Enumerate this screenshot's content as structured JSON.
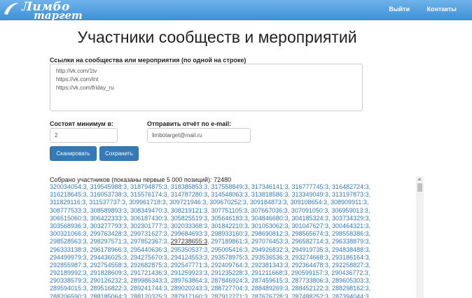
{
  "navbar": {
    "logo_line1": "Лимбо",
    "logo_line2": "таргет",
    "links": [
      "Выйти",
      "Контакты"
    ]
  },
  "page_title": "Участники сообществ и мероприятий",
  "links_field": {
    "label": "Ссылки на сообщества или мероприятия (по одной на строке)",
    "lines": [
      "http://vk.com/1tv",
      "https://vk.com/tnt",
      "https://vk.com/friday_ru"
    ]
  },
  "min_field": {
    "label": "Состоят минимум в:",
    "value": "2"
  },
  "email_field": {
    "label": "Отправить отчёт по e-mail:",
    "value": "limbotarget@mail.ru"
  },
  "buttons": {
    "scan": "Сканировать",
    "save": "Сохранить"
  },
  "results": {
    "title": "Собрано участников (показаны первые 5 000 позиций): 72480",
    "rows": [
      [
        "320034054:3",
        "319545988:3",
        "318794875:3",
        "318385853:3",
        "317558849:3",
        "317346141:3",
        "316777745:3",
        "316482724:3"
      ],
      [
        "316218645:3",
        "316053738:3",
        "315576174:3",
        "314787280:3",
        "314548063:3",
        "313818586:3",
        "313349049:3",
        "313197873:3"
      ],
      [
        "311829116:3",
        "311537737:3",
        "309961718:3",
        "309721946:3",
        "309670252:3",
        "309184873:3",
        "309108654:3",
        "308909911:3"
      ],
      [
        "308777533:3",
        "308589893:3",
        "308349470:3",
        "308219121:3",
        "307751105:3",
        "307667036:3",
        "307091050:3",
        "306959013:3"
      ],
      [
        "306515060:3",
        "306422333:3",
        "306187430:3",
        "305825519:3",
        "305646183:3",
        "304846680:3",
        "304185324:3",
        "303734329:3"
      ],
      [
        "303568936:3",
        "303277793:3",
        "302301777:3",
        "302033368:3",
        "301842210:3",
        "301053062:3",
        "301047627:3",
        "300464321:3"
      ],
      [
        "300321066:3",
        "299763428:3",
        "299731627:3",
        "299684693:3",
        "298933160:3",
        "298690812:3",
        "298565674:3",
        "298558386:3"
      ],
      [
        "298528563:3",
        "298297571:3",
        "297852367:3",
        "297238655:3",
        "297189861:3",
        "297076453:3",
        "296582714:3",
        "296338879:3"
      ],
      [
        "296333138:3",
        "296178966:3",
        "295440636:3",
        "295350537:3",
        "295005416:3",
        "294926832:3",
        "294919735:3",
        "294838488:3"
      ],
      [
        "294499979:3",
        "294436025:3",
        "294275670:3",
        "294124553:3",
        "293578975:3",
        "293536536:3",
        "293274668:3",
        "293186164:3"
      ],
      [
        "292855987:3",
        "292754558:3",
        "292682875:3",
        "292547771:3",
        "292409764:3",
        "292381343:3",
        "292364478:3",
        "292258827:3"
      ],
      [
        "292189992:3",
        "291828609:3",
        "291721436:3",
        "291259923:3",
        "291235228:3",
        "291211668:3",
        "290599157:3",
        "290436772:3"
      ],
      [
        "290338579:3",
        "290126232:3",
        "289986343:3",
        "289763864:3",
        "287846924:3",
        "287459615:3",
        "287733806:3",
        "289605303:3"
      ],
      [
        "289594015:3",
        "289516822:3",
        "289241744:3",
        "289020243:3",
        "288727704:3",
        "288489269:3",
        "288452122:3",
        "288298162:3"
      ],
      [
        "288206590:3",
        "288185064:3",
        "288120325:3",
        "287917160:3",
        "287912271:3",
        "287676728:3",
        "287488252:3",
        "287394044:3"
      ]
    ]
  }
}
